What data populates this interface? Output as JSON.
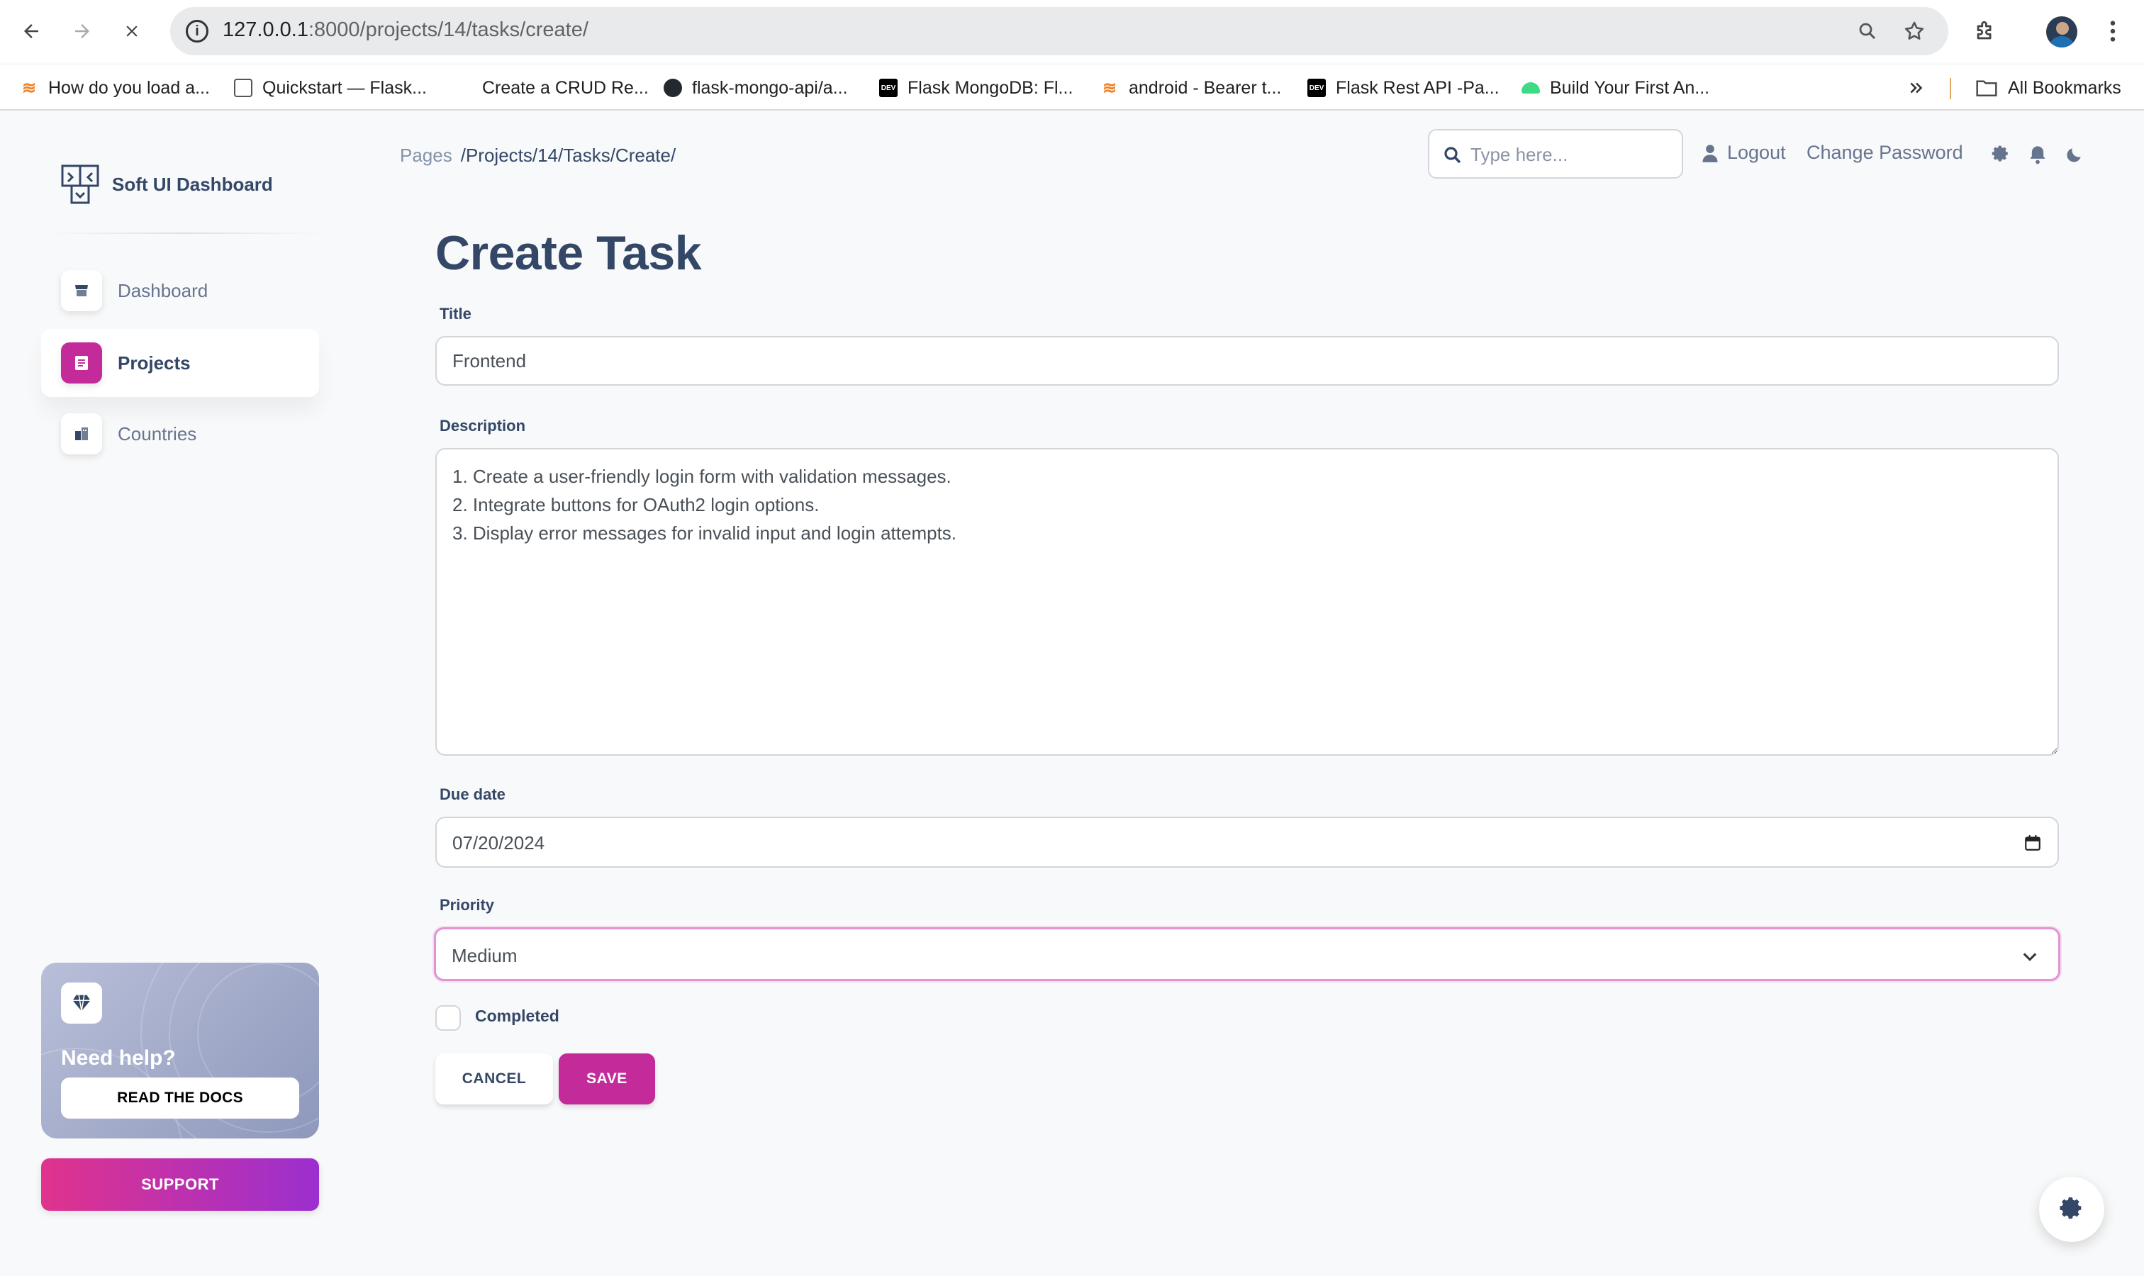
{
  "browser": {
    "url_host": "127.0.0.1",
    "url_path": ":8000/projects/14/tasks/create/",
    "bookmarks": [
      {
        "label": "How do you load a...",
        "icon": "stackoverflow-icon"
      },
      {
        "label": "Quickstart — Flask...",
        "icon": "doc-icon"
      },
      {
        "label": "Create a CRUD Re...",
        "icon": "blank-icon"
      },
      {
        "label": "flask-mongo-api/a...",
        "icon": "github-icon"
      },
      {
        "label": "Flask MongoDB: Fl...",
        "icon": "dev-icon"
      },
      {
        "label": "android - Bearer t...",
        "icon": "stackoverflow-icon"
      },
      {
        "label": "Flask Rest API -Pa...",
        "icon": "dev-icon"
      },
      {
        "label": "Build Your First An...",
        "icon": "android-icon"
      }
    ],
    "all_bookmarks_label": "All Bookmarks",
    "dev_badge": "DEV"
  },
  "sidebar": {
    "brand": "Soft UI Dashboard",
    "items": [
      {
        "label": "Dashboard",
        "icon": "shop-icon",
        "active": false
      },
      {
        "label": "Projects",
        "icon": "document-icon",
        "active": true
      },
      {
        "label": "Countries",
        "icon": "office-icon",
        "active": false
      }
    ],
    "help_card": {
      "title": "Need help?",
      "button": "READ THE DOCS"
    },
    "support_button": "SUPPORT"
  },
  "navbar": {
    "breadcrumb_root": "Pages",
    "breadcrumb_current": "/Projects/14/Tasks/Create/",
    "search_placeholder": "Type here...",
    "logout": "Logout",
    "change_password": "Change Password"
  },
  "form": {
    "heading": "Create Task",
    "title_label": "Title",
    "title_value": "Frontend",
    "description_label": "Description",
    "description_value": "1. Create a user-friendly login form with validation messages.\n2. Integrate buttons for OAuth2 login options.\n3. Display error messages for invalid input and login attempts.",
    "due_date_label": "Due date",
    "due_date_value": "07/20/2024",
    "priority_label": "Priority",
    "priority_value": "Medium",
    "completed_label": "Completed",
    "cancel_button": "CANCEL",
    "save_button": "SAVE"
  },
  "colors": {
    "accent": "#c42b9a",
    "text_dark": "#344767",
    "text_muted": "#67748e"
  }
}
